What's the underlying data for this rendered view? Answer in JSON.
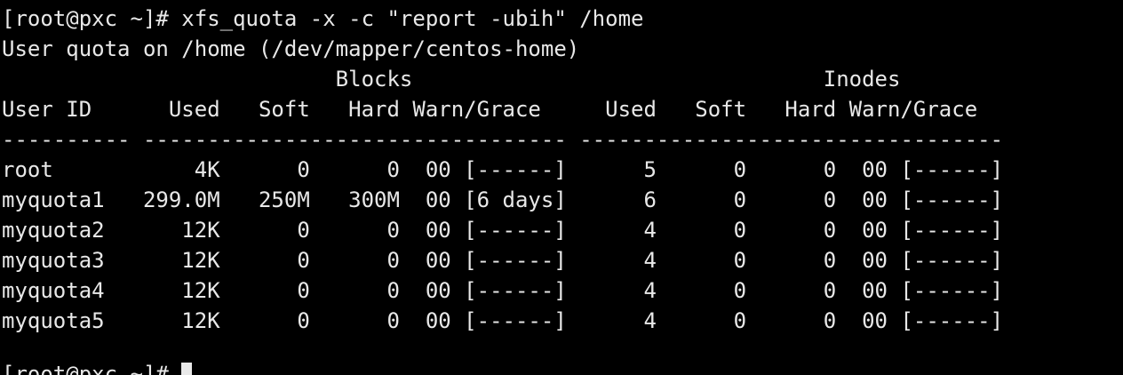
{
  "terminal": {
    "command_line": "[root@pxc ~]# xfs_quota -x -c \"report -ubih\" /home",
    "header_line": "User quota on /home (/dev/mapper/centos-home)",
    "group_header": "                          Blocks                                Inodes",
    "columns_header": "User ID      Used   Soft   Hard Warn/Grace     Used   Soft   Hard Warn/Grace",
    "separator": "---------- --------------------------------- ---------------------------------",
    "rows": [
      "root           4K      0      0  00 [------]      5      0      0  00 [------]",
      "myquota1   299.0M   250M   300M  00 [6 days]      6      0      0  00 [------]",
      "myquota2      12K      0      0  00 [------]      4      0      0  00 [------]",
      "myquota3      12K      0      0  00 [------]      4      0      0  00 [------]",
      "myquota4      12K      0      0  00 [------]      4      0      0  00 [------]",
      "myquota5      12K      0      0  00 [------]      4      0      0  00 [------]"
    ],
    "blank_line": "",
    "prompt": "[root@pxc ~]# "
  }
}
